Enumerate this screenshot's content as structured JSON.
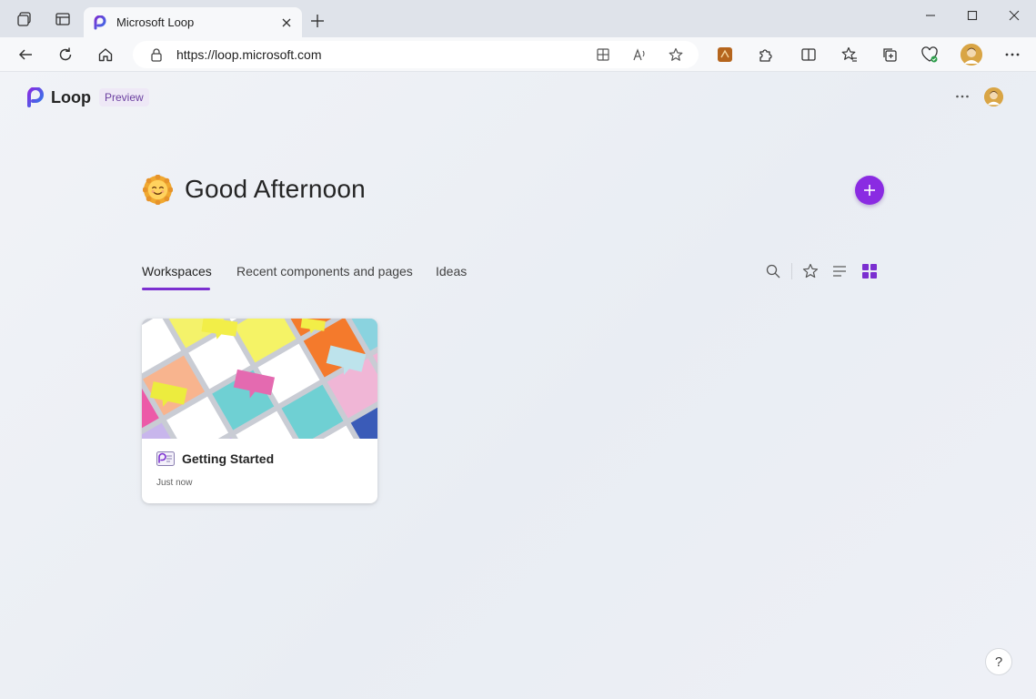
{
  "browser": {
    "tab_title": "Microsoft Loop",
    "url": "https://loop.microsoft.com"
  },
  "app": {
    "name": "Loop",
    "badge": "Preview",
    "greeting": "Good Afternoon"
  },
  "tabs": [
    {
      "label": "Workspaces",
      "active": true
    },
    {
      "label": "Recent components and pages",
      "active": false
    },
    {
      "label": "Ideas",
      "active": false
    }
  ],
  "workspaces": [
    {
      "title": "Getting Started",
      "updated": "Just now"
    }
  ],
  "help": "?",
  "colors": {
    "accent": "#8a2be2",
    "tab_underline": "#7b2fd0",
    "preview_bg": "#eee8f6",
    "preview_text": "#6b3fa0"
  }
}
